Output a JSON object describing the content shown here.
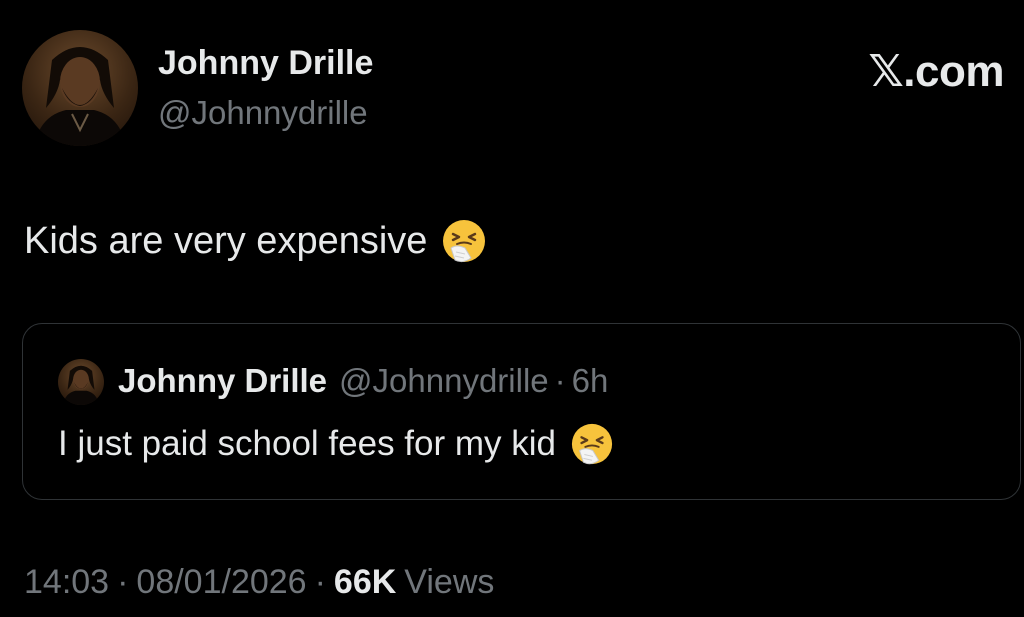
{
  "header": {
    "author_name": "Johnny Drille",
    "author_handle": "@Johnnydrille",
    "brand": "𝕏.com"
  },
  "tweet": {
    "text": "Kids are very expensive",
    "emoji": "sneezing-face"
  },
  "quote": {
    "author_name": "Johnny Drille",
    "author_handle": "@Johnnydrille",
    "separator": "·",
    "time_ago": "6h",
    "text": "I just paid school fees for my kid",
    "emoji": "sneezing-face"
  },
  "meta": {
    "time": "14:03",
    "separator": "·",
    "date": "08/01/2026",
    "views_count": "66K",
    "views_label": "Views"
  },
  "colors": {
    "background": "#000000",
    "primary_text": "#e7e9ea",
    "secondary_text": "#71767b",
    "border": "#2f3336"
  }
}
